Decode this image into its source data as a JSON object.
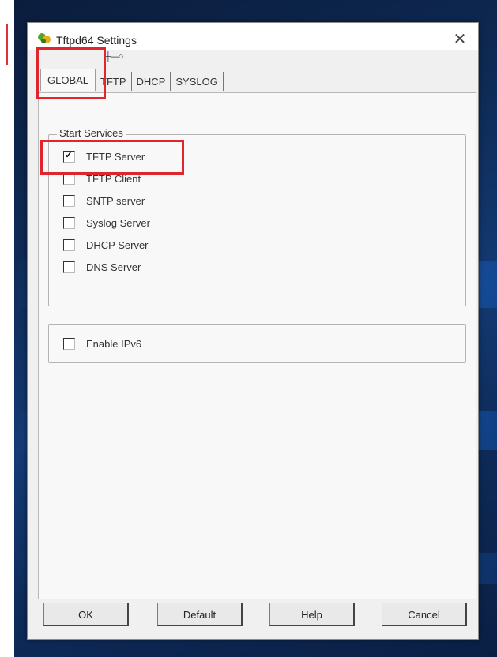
{
  "window": {
    "title": "Tftpd64 Settings",
    "close_label": "✕",
    "tab_marker": "┼—○"
  },
  "tabs": [
    {
      "label": "GLOBAL",
      "active": true
    },
    {
      "label": "TFTP",
      "active": false
    },
    {
      "label": "DHCP",
      "active": false
    },
    {
      "label": "SYSLOG",
      "active": false
    }
  ],
  "start_services": {
    "title": "Start Services",
    "items": [
      {
        "label": "TFTP Server",
        "checked": true
      },
      {
        "label": "TFTP Client",
        "checked": false
      },
      {
        "label": "SNTP server",
        "checked": false
      },
      {
        "label": "Syslog Server",
        "checked": false
      },
      {
        "label": "DHCP Server",
        "checked": false
      },
      {
        "label": "DNS Server",
        "checked": false
      }
    ]
  },
  "ipv6": {
    "label": "Enable IPv6",
    "checked": false
  },
  "buttons": {
    "ok": "OK",
    "default": "Default",
    "help": "Help",
    "cancel": "Cancel"
  },
  "colors": {
    "highlight": "#e0262a",
    "dialog_bg": "#f0f0f0",
    "desktop_bg": "#0e2a55"
  },
  "icons": {
    "app": "tftpd-app-icon",
    "close": "close-icon"
  }
}
